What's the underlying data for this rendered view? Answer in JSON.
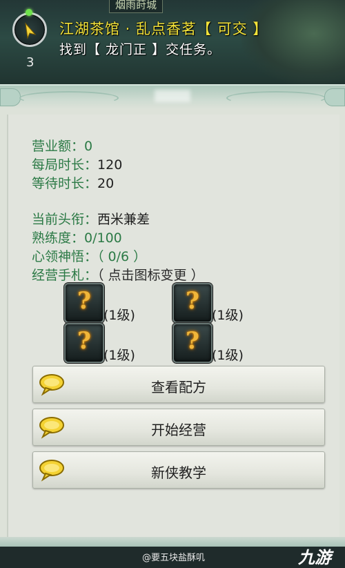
{
  "scene": {
    "location": "烟雨莳城"
  },
  "quest_tracker": {
    "count": "3",
    "title": "江湖茶馆 · 乱点香茗【 可交 】",
    "description": "找到【 龙门正 】交任务。"
  },
  "stats": {
    "revenue_label": "营业额：",
    "revenue_value": "0",
    "round_time_label": "每局时长：",
    "round_time_value": "120",
    "wait_time_label": "等待时长：",
    "wait_time_value": "20",
    "title_label": "当前头衔：",
    "title_value": "西米兼差",
    "proficiency_label": "熟练度：",
    "proficiency_value": "0/100",
    "insight_label": "心领神悟：",
    "insight_value": "（ 0/6 ）",
    "manual_label": "经营手札：",
    "manual_value": "（ 点击图标变更 ）"
  },
  "slots": [
    {
      "icon": "question-mark-icon",
      "glyph": "?",
      "level": "(1级)"
    },
    {
      "icon": "question-mark-icon",
      "glyph": "?",
      "level": "(1级)"
    },
    {
      "icon": "question-mark-icon",
      "glyph": "?",
      "level": "(1级)"
    },
    {
      "icon": "question-mark-icon",
      "glyph": "?",
      "level": "(1级)"
    }
  ],
  "buttons": [
    {
      "label": "查看配方",
      "icon": "speech-bubble-icon"
    },
    {
      "label": "开始经营",
      "icon": "speech-bubble-icon"
    },
    {
      "label": "新侠教学",
      "icon": "speech-bubble-icon"
    }
  ],
  "watermark": {
    "text": "@要五块盐酥叽",
    "brand": "九游"
  },
  "colors": {
    "quest_title": "#f3e33a",
    "label_green": "#2c7a46",
    "panel_bg": "#dde2d9",
    "icon_glow": "#f0b63a"
  }
}
